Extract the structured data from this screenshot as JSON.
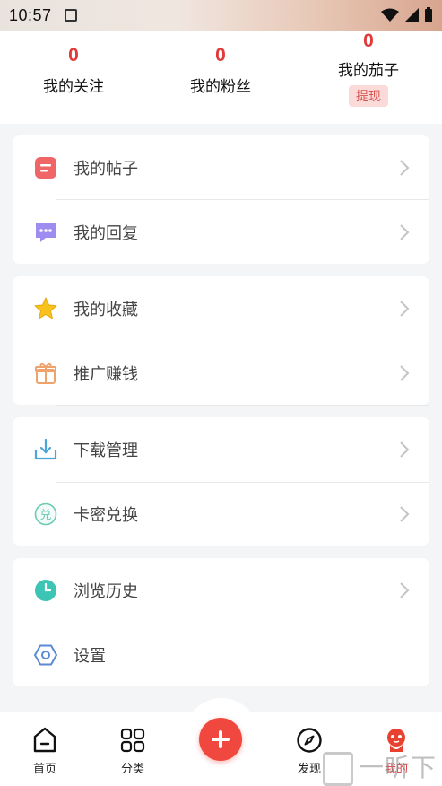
{
  "status": {
    "time": "10:57"
  },
  "stats": {
    "following": {
      "value": "0",
      "label": "我的关注"
    },
    "fans": {
      "value": "0",
      "label": "我的粉丝"
    },
    "eggplant": {
      "value": "0",
      "label": "我的茄子",
      "action": "提现"
    }
  },
  "menu": {
    "group1": [
      {
        "label": "我的帖子",
        "icon": "post-icon"
      },
      {
        "label": "我的回复",
        "icon": "reply-icon"
      }
    ],
    "group2": [
      {
        "label": "我的收藏",
        "icon": "star-icon"
      },
      {
        "label": "推广赚钱",
        "icon": "gift-icon"
      }
    ],
    "group3": [
      {
        "label": "下载管理",
        "icon": "download-icon"
      },
      {
        "label": "卡密兑换",
        "icon": "redeem-icon"
      }
    ],
    "group4": [
      {
        "label": "浏览历史",
        "icon": "clock-icon"
      },
      {
        "label": "设置",
        "icon": "settings-icon"
      }
    ]
  },
  "nav": {
    "home": "首页",
    "category": "分类",
    "discover": "发现",
    "mine": "我的"
  },
  "colors": {
    "accent": "#e03a3a",
    "fab": "#f0483e"
  },
  "watermark": "一听下载"
}
